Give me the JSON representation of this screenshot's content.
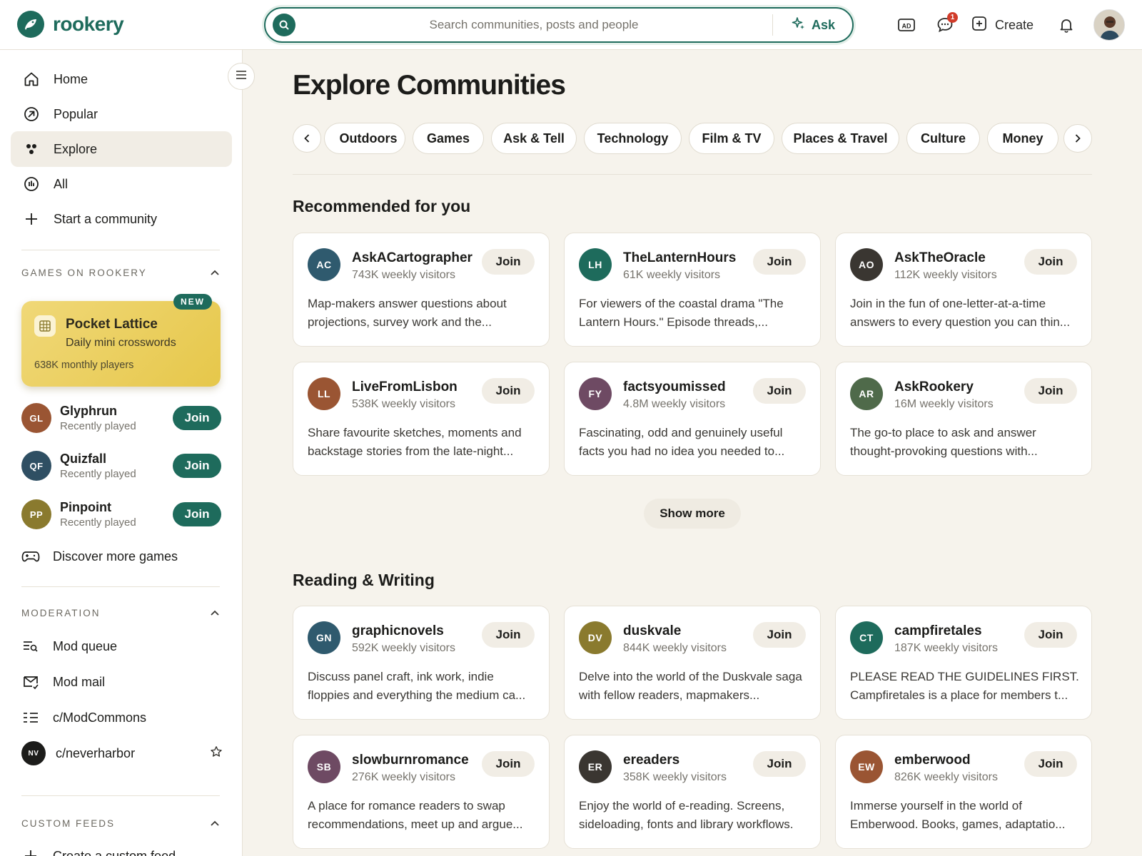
{
  "brand": {
    "name": "rookery"
  },
  "search": {
    "placeholder": "Search communities, posts and people",
    "ask_label": "Ask"
  },
  "header": {
    "notifications_count": "1",
    "create_label": "Create",
    "ad_label": "AD"
  },
  "sidebar": {
    "nav": [
      {
        "label": "Home",
        "icon": "home-icon"
      },
      {
        "label": "Popular",
        "icon": "popular-icon"
      },
      {
        "label": "Explore",
        "icon": "explore-icon",
        "active": true
      },
      {
        "label": "All",
        "icon": "all-icon"
      },
      {
        "label": "Start a community",
        "icon": "plus-icon"
      }
    ],
    "games_section": {
      "title": "GAMES ON ROOKERY",
      "featured": {
        "badge": "NEW",
        "title": "Pocket Lattice",
        "subtitle": "Daily mini crosswords",
        "players": "638K monthly players"
      },
      "games": [
        {
          "initials": "GL",
          "name": "Glyphrun",
          "sub": "Recently played",
          "join": "Join",
          "color": "#9a5533"
        },
        {
          "initials": "QF",
          "name": "Quizfall",
          "sub": "Recently played",
          "join": "Join",
          "color": "#2f4f63"
        },
        {
          "initials": "PP",
          "name": "Pinpoint",
          "sub": "Recently played",
          "join": "Join",
          "color": "#8a7a2e"
        }
      ],
      "discover": "Discover more games"
    },
    "moderation": {
      "title": "MODERATION",
      "items": [
        {
          "label": "Mod queue",
          "icon": "mod-queue-icon"
        },
        {
          "label": "Mod mail",
          "icon": "mail-icon"
        },
        {
          "label": "c/ModCommons",
          "icon": "list-icon"
        },
        {
          "label": "c/neverharbor",
          "icon": "community-avatar",
          "initials": "NV"
        }
      ]
    },
    "custom_feeds": {
      "title": "CUSTOM FEEDS",
      "first_item": "Create a custom feed"
    }
  },
  "main": {
    "title": "Explore Communities",
    "chips": [
      "Outdoors",
      "Games",
      "Ask & Tell",
      "Technology",
      "Film & TV",
      "Places & Travel",
      "Culture",
      "Money"
    ],
    "recommended": {
      "title": "Recommended for you",
      "cards": [
        {
          "initials": "AC",
          "name": "AskACartographer",
          "visitors": "743K weekly visitors",
          "desc": "Map-makers answer questions about projections, survey work and the...",
          "color": "#2f5a6e"
        },
        {
          "initials": "LH",
          "name": "TheLanternHours",
          "visitors": "61K weekly visitors",
          "desc": "For viewers of the coastal drama \"The Lantern Hours.\" Episode threads,...",
          "color": "#1e6b5c"
        },
        {
          "initials": "AO",
          "name": "AskTheOracle",
          "visitors": "112K weekly visitors",
          "desc": "Join in the fun of one-letter-at-a-time answers to every question you can thin...",
          "color": "#3a3631"
        },
        {
          "initials": "LL",
          "name": "LiveFromLisbon",
          "visitors": "538K weekly visitors",
          "desc": "Share favourite sketches, moments and backstage stories from the late-night...",
          "color": "#9a5533"
        },
        {
          "initials": "FY",
          "name": "factsyoumissed",
          "visitors": "4.8M weekly visitors",
          "desc": "Fascinating, odd and genuinely useful facts you had no idea you needed to...",
          "color": "#6e4a63"
        },
        {
          "initials": "AR",
          "name": "AskRookery",
          "visitors": "16M weekly visitors",
          "desc": "The go-to place to ask and answer thought-provoking questions with...",
          "color": "#4f6a4a"
        }
      ],
      "show_more": "Show more"
    },
    "reading": {
      "title": "Reading & Writing",
      "cards": [
        {
          "initials": "GN",
          "name": "graphicnovels",
          "visitors": "592K weekly visitors",
          "desc": "Discuss panel craft, ink work, indie floppies and everything the medium ca...",
          "color": "#2f5a6e"
        },
        {
          "initials": "DV",
          "name": "duskvale",
          "visitors": "844K weekly visitors",
          "desc": "Delve into the world of the Duskvale saga with fellow readers, mapmakers...",
          "color": "#8a7a2e"
        },
        {
          "initials": "CT",
          "name": "campfiretales",
          "visitors": "187K weekly visitors",
          "desc": "PLEASE READ THE GUIDELINES FIRST. Campfiretales is a place for members t...",
          "color": "#1e6b5c"
        },
        {
          "initials": "SB",
          "name": "slowburnromance",
          "visitors": "276K weekly visitors",
          "desc": "A place for romance readers to swap recommendations, meet up and argue...",
          "color": "#6e4a63"
        },
        {
          "initials": "ER",
          "name": "ereaders",
          "visitors": "358K weekly visitors",
          "desc": "Enjoy the world of e-reading. Screens, sideloading, fonts and library workflows.",
          "color": "#3a3631"
        },
        {
          "initials": "EW",
          "name": "emberwood",
          "visitors": "826K weekly visitors",
          "desc": "Immerse yourself in the world of Emberwood. Books, games, adaptatio...",
          "color": "#9a5533"
        }
      ]
    },
    "join_label": "Join"
  },
  "colors": {
    "accent": "#1e6b5c",
    "background": "#f6f3ec",
    "featured_game": "#e6c74a",
    "badge": "#d13c2a"
  }
}
